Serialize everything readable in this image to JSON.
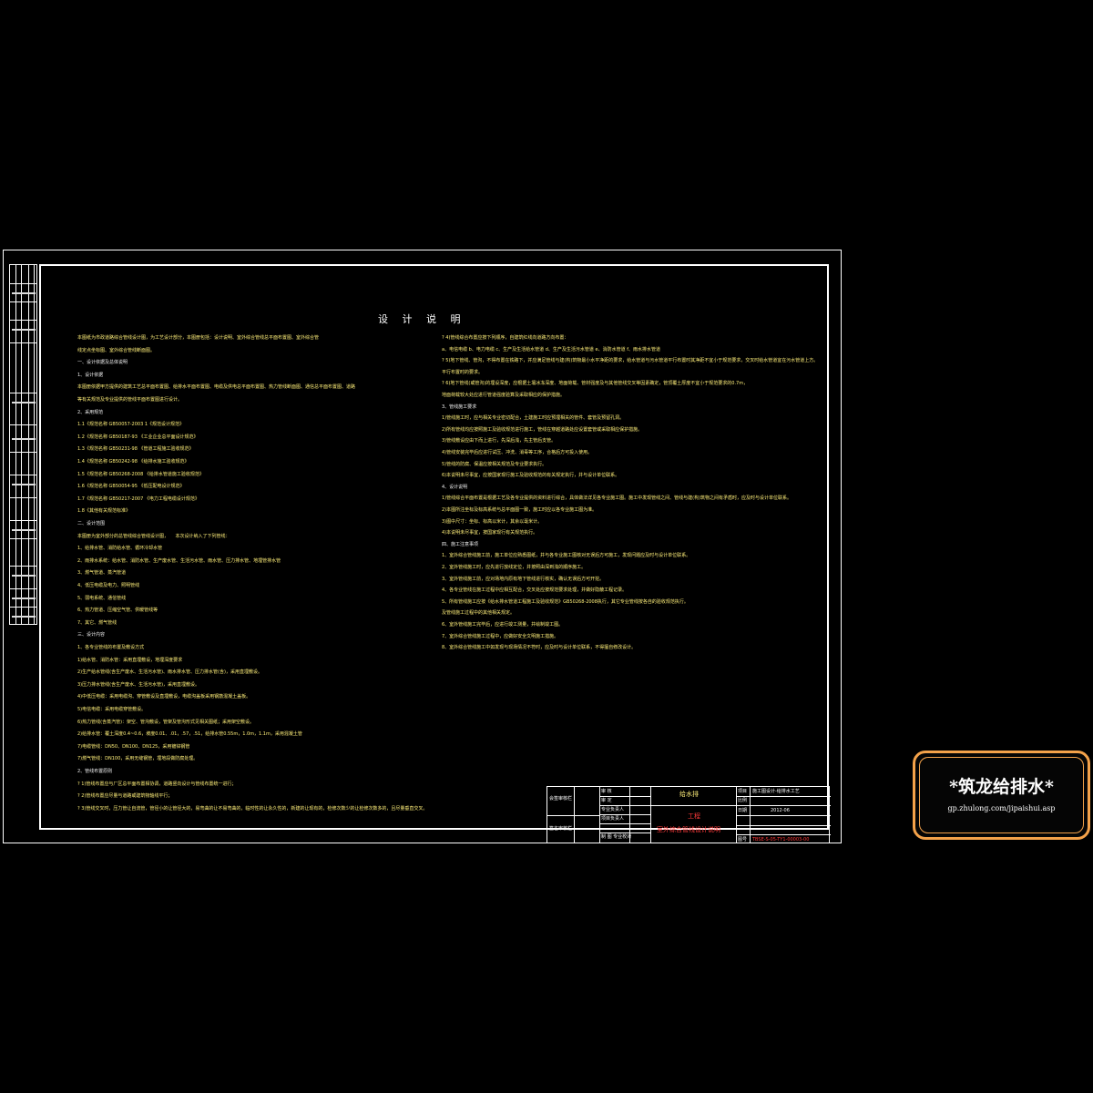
{
  "drawing": {
    "title": "设 计 说 明",
    "left_column": [
      "本图纸为市政道路综合管线设计图，为工艺设计部分，本图册包括：设计说明、室外综合管线总平面布置图、室外综合管",
      "线定点坐标图、室外综合管线断面图。",
      "一、设计依据及总体说明",
      "1、设计依据",
      "本图册依据甲方提供的建筑工艺总平面布置图、给排水平面布置图、电缆及供电总平面布置图、热力管线断面图、通信总平面布置图、道路",
      "等有关规范及专业提供的管线平面布置图进行设计。",
      "2、采用规范",
      "1.1《规范名称 GB50057-2003 1《规范设计规范》",
      "1.2《规范名称 GB50187-93 《工业企业总平面设计规范》",
      "1.3《规范名称 GB50231-98 《管道工程施工验收规范》",
      "1.4《规范名称 GB50242-98 《给排水施工验收规范》",
      "1.5《规范名称 GB50268-2008 《给排水管道施工验收规范》",
      "1.6《规范名称 GB50054-95 《低压配电设计规范》",
      "1.7《规范名称 GB50217-2007 《电力工程电缆设计规范》",
      "1.8《其他有关规范标准》",
      "二、设计范围",
      "本图册为室外部分的总管线综合管线设计图，　　本次设计纳入了下列管线：",
      "1、给排水管、消防给水管、循环冷却水管",
      "2、雨排水系统：给水管、消防水管、生产废水管、生活污水管、雨水管、压力排水管、地埋管排水管",
      "3、燃气管道、蒸汽管道",
      "4、低压电缆及电力、照明管线",
      "5、弱电系统、通信管线",
      "6、热力管道、压缩空气管、供暖管线等",
      "7、其它、燃气管线",
      "三、设计内容",
      "1、各专业管线的布置及敷设方式",
      "1)给水管、消防水管：采用直埋敷设，地埋深度要求",
      "2)生产给水管线(含生产废水、生活污水管)、雨水排水管、压力排水管(含)，采用直埋敷设。",
      "3)压力排水管线(含生产废水、生活污水管)，采用直埋敷设。",
      "4)中低压电缆：采用电缆沟、穿管敷设及直埋敷设，电缆沟盖板采用钢筋混凝土盖板。",
      "5)电信电缆：采用电缆穿管敷设。",
      "6)热力管线(含蒸汽管)：架空、管沟敷设，管架及管沟形式见相关图纸；采用架空敷设。",
      "2)给排水管：覆土深度0.4~0.6，坡度0.01、.01，.57，.51，给排水管0.55m，1.0m，1.1m，采用混凝土管",
      "7)电缆管线：DN50、DN100、DN125，采用镀锌钢管",
      "7)燃气管线：DN100，采用无缝钢管，埋地段做防腐处理。",
      "2、管线布置原则",
      "? 1)管线布置应与厂区总平面布置相协调，道路竖向设计与管线布置统一进行；",
      "? 2)管线布置应尽量与道路或建筑物轴线平行；",
      "? 3)管线交叉时，压力管让自流管，管径小的让管径大的，易弯曲的让不易弯曲的，临时性的让永久性的，新建的让现有的，检修次数少的让检修次数多的，且尽量垂直交叉。"
    ],
    "right_column": [
      "? 4)管线综合布置应按下列顺序，自建筑红线向道路方向布置：",
      "a、电信电缆 b、电力电缆 c、生产及生活给水管道 d、生产及生活污水管道 e、消防水管道 f、雨水排水管道",
      "? 5)地下管线、管沟，不得布置在铁路下，并应满足管线与建(构)筑物最小水平净距的要求，给水管道与污水管道平行布置时其净距不宜小于规范要求，交叉时给水管道宜在污水管道上方。",
      "平行布置时的要求。",
      "? 6)地下管线(或管沟)的埋设深度，应根据土壤冰冻深度、地面荷载、管材强度及与其他管线交叉等因素确定，管顶覆土厚度不宜小于规范要求的0.7m，",
      "地面荷载较大处应进行管道强度验算及采取相应的保护措施。",
      "3、管线施工要求",
      "1)管线施工时，应与相关专业密切配合，土建施工时应预埋相关的管件、套管及预留孔洞。",
      "2)所有管线均应按照施工及验收规范进行施工，管线在穿越道路处应设置套管或采取相应保护措施。",
      "3)管线敷设应由下而上进行，先深后浅，先主管后支管。",
      "4)管线安装完毕后应进行试压、冲洗、消毒等工序，合格后方可投入使用。",
      "5)管线的防腐、保温应按相关规范及专业要求执行。",
      "6)本说明未尽事宜，应按国家现行施工及验收规范的有关规定执行，并与设计单位联系。",
      "4、设计说明",
      "1)管线综合平面布置是根据工艺及各专业提供的资料进行综合，具体做法详见各专业施工图。施工中发现管线之间、管线与建(构)筑物之间有矛盾时，应及时与设计单位联系。",
      "2)本图所注坐标及标高系统与总平面图一致，施工时应以各专业施工图为准。",
      "3)图中尺寸：坐标、标高以米计，其余以毫米计。",
      "4)本说明未尽事宜，按国家现行有关规范执行。",
      "四、施工注意事项",
      "1、室外综合管线施工前，施工单位应熟悉图纸，并与各专业施工图核对无误后方可施工，发现问题应及时与设计单位联系。",
      "2、室外管线施工时，应先进行放线定位，并按照由深到浅的顺序施工。",
      "3、室外管线施工前，应对场地内原有地下管线进行核实，确认无误后方可开挖。",
      "4、各专业管线在施工过程中应相互配合，交叉处应按规范要求处理，并做好隐蔽工程记录。",
      "5、所有管线施工应按《给水排水管道工程施工及验收规范》GB50268-2008执行，其它专业管线按各自的验收规范执行。",
      "及管线施工过程中的其他相关规定。",
      "6、室外管线施工完毕后，应进行竣工测量，并绘制竣工图。",
      "7、室外综合管线施工过程中，应做好安全文明施工措施。",
      "8、室外综合管线施工中如发现与现场情况不符时，应及时与设计单位联系，不得擅自修改设计。"
    ],
    "title_block": {
      "review_label": "会签审核栏",
      "sign_label": "签名审核栏",
      "roles": [
        "审 核",
        "审 定",
        "专业负责人",
        "项目负责人",
        "制 图 专业校对"
      ],
      "company": "给水排",
      "project": "工程",
      "drawing_name": "室外综合管线设计说明",
      "fields": [
        {
          "label": "项目",
          "value": "施工图设计-给排水工艺"
        },
        {
          "label": "比例",
          "value": ""
        },
        {
          "label": "日期",
          "value": "2012-06"
        },
        {
          "label": "图号",
          "value": "TBSE-S-05-TY1-00003-00"
        }
      ]
    }
  },
  "watermark": {
    "title": "*筑龙给排水*",
    "url": "gp.zhulong.com/jipaishui.asp",
    "colors": {
      "border": "#f4a24a",
      "text": "#ffffff"
    }
  }
}
